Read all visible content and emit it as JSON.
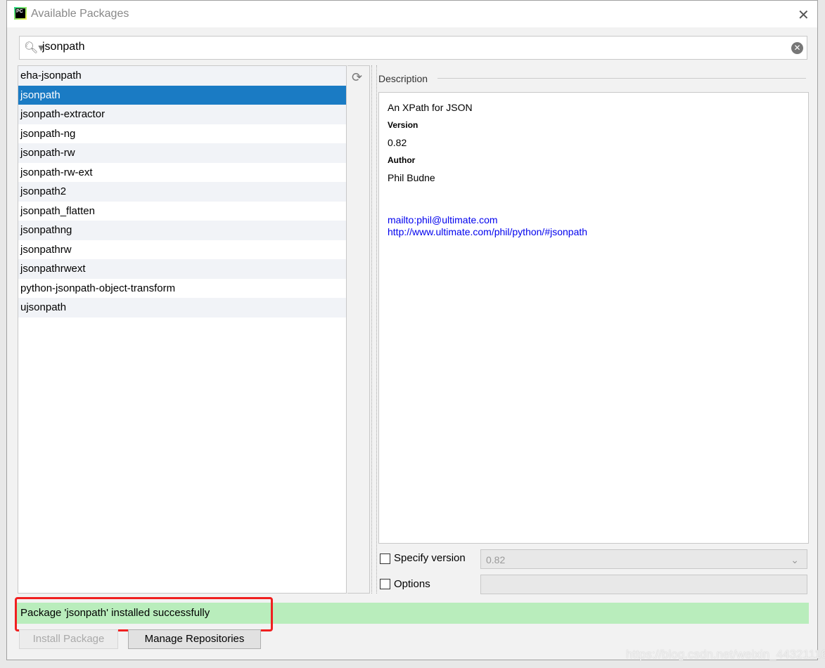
{
  "window": {
    "title": "Available Packages"
  },
  "search": {
    "value": "jsonpath"
  },
  "packages": [
    "eha-jsonpath",
    "jsonpath",
    "jsonpath-extractor",
    "jsonpath-ng",
    "jsonpath-rw",
    "jsonpath-rw-ext",
    "jsonpath2",
    "jsonpath_flatten",
    "jsonpathng",
    "jsonpathrw",
    "jsonpathrwext",
    "python-jsonpath-object-transform",
    "ujsonpath"
  ],
  "selected_package": "jsonpath",
  "description": {
    "label": "Description",
    "summary": "An XPath for JSON",
    "version_label": "Version",
    "version": "0.82",
    "author_label": "Author",
    "author": "Phil Budne",
    "email_link": "mailto:phil@ultimate.com",
    "url_link": "http://www.ultimate.com/phil/python/#jsonpath"
  },
  "options": {
    "specify_version_label": "Specify version",
    "specify_version_checked": false,
    "version_value": "0.82",
    "options_label": "Options",
    "options_checked": false,
    "options_value": ""
  },
  "status": {
    "message": "Package 'jsonpath' installed successfully",
    "color": "#b9edbc"
  },
  "buttons": {
    "install": "Install Package",
    "manage": "Manage Repositories"
  },
  "watermark": "https://blog.csdn.net/weixin_44321116"
}
